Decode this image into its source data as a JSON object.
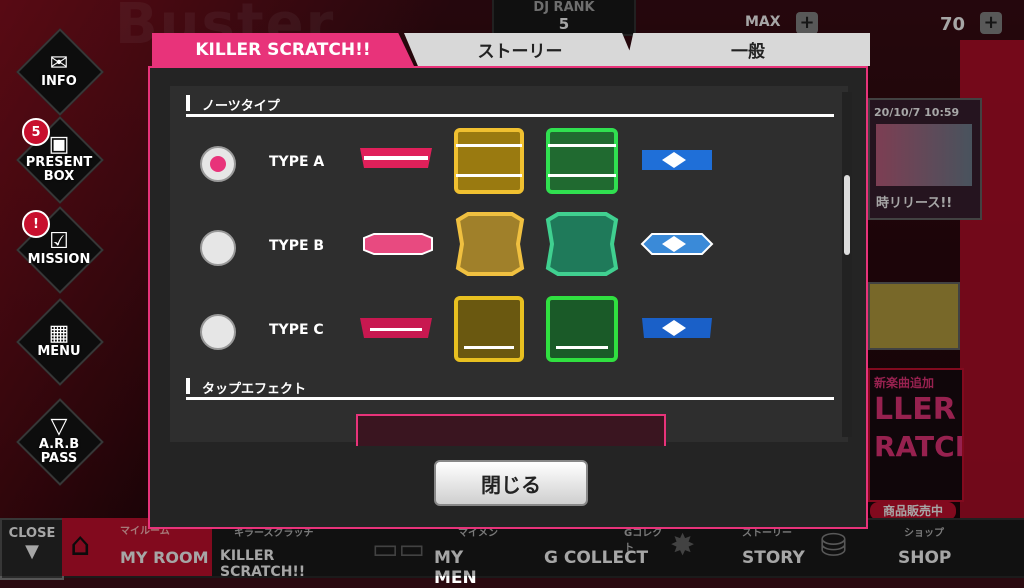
{
  "header": {
    "dj_rank_label": "DJ RANK",
    "dj_rank_value": "5",
    "max_label": "MAX",
    "gem_count": "70",
    "bg_text": "Buster"
  },
  "sidebar": {
    "items": [
      {
        "label": "INFO"
      },
      {
        "label": "PRESENT\nBOX",
        "badge": "5"
      },
      {
        "label": "MISSION",
        "badge": "!"
      },
      {
        "label": "MENU"
      },
      {
        "label": "A.R.B\nPASS"
      }
    ]
  },
  "right_banners": {
    "date": "20/10/7 10:59",
    "release": "時リリース!!",
    "new_songs": "新楽曲追加",
    "killer": "LLER",
    "scratch": "RATCH!!",
    "shop_sale": "商品販売中"
  },
  "bottom_nav": {
    "close": "CLOSE",
    "items": [
      {
        "sub": "マイルーム",
        "main": "MY ROOM"
      },
      {
        "sub": "キラースクラッチ",
        "main": "KILLER SCRATCH!!"
      },
      {
        "sub": "マイメン",
        "main": "MY MEN"
      },
      {
        "sub": "Gコレクト",
        "main": "G COLLECT"
      },
      {
        "sub": "ストーリー",
        "main": "STORY"
      },
      {
        "sub": "ショップ",
        "main": "SHOP"
      }
    ]
  },
  "modal": {
    "tabs": [
      {
        "label": "KILLER SCRATCH!!",
        "active": true
      },
      {
        "label": "ストーリー",
        "active": false
      },
      {
        "label": "一般",
        "active": false
      }
    ],
    "section_notes_title": "ノーツタイプ",
    "section_tap_title": "タップエフェクト",
    "note_types": [
      {
        "label": "TYPE A",
        "selected": true
      },
      {
        "label": "TYPE B",
        "selected": false
      },
      {
        "label": "TYPE C",
        "selected": false
      }
    ],
    "close_label": "閉じる"
  },
  "colors": {
    "accent": "#e8337a",
    "red": "#c8102e",
    "note_pink": "#e0205a",
    "note_yellow": "#e8b820",
    "note_green": "#20c040",
    "note_blue": "#2080e0"
  }
}
